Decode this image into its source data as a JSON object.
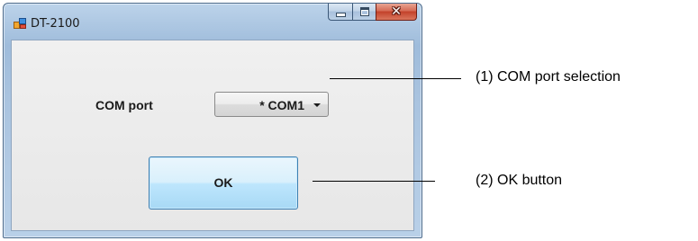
{
  "window": {
    "title": "DT-2100",
    "icon": "application-window-icon",
    "caption_buttons": {
      "minimize": "minimize-icon",
      "maximize": "maximize-icon",
      "close": "close-icon"
    }
  },
  "form": {
    "com_port_label": "COM port",
    "com_port_value": "* COM1",
    "ok_label": "OK"
  },
  "annotations": {
    "com_port_selection": "(1) COM port selection",
    "ok_button": "(2) OK button"
  },
  "colors": {
    "title_bar": "#a9c3df",
    "close_button": "#c3412a",
    "ok_button_face": "#bee6fd",
    "client_area": "#ececec"
  }
}
